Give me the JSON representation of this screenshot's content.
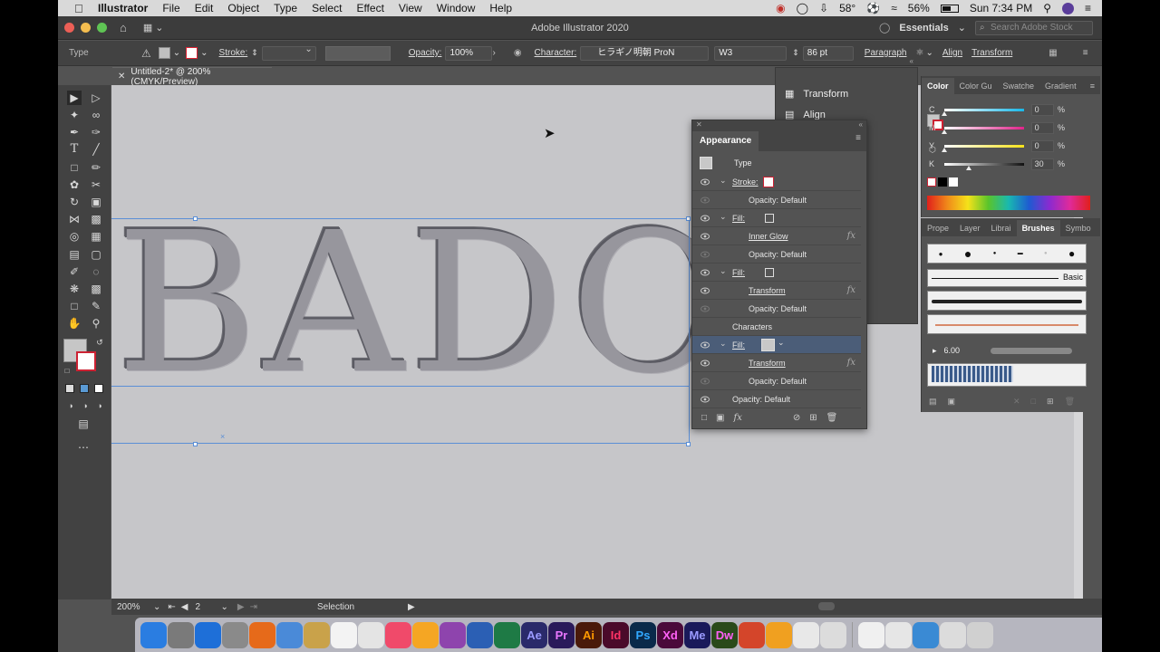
{
  "menubar": {
    "apple": "",
    "app": "Illustrator",
    "items": [
      "File",
      "Edit",
      "Object",
      "Type",
      "Select",
      "Effect",
      "View",
      "Window",
      "Help"
    ],
    "temperature": "58°",
    "battery": "56%",
    "clock": "Sun 7:34 PM"
  },
  "window": {
    "title": "Adobe Illustrator 2020",
    "workspace": "Essentials",
    "search_placeholder": "Search Adobe Stock"
  },
  "controlbar": {
    "selection_type": "Type",
    "stroke_label": "Stroke:",
    "opacity_label": "Opacity:",
    "opacity_value": "100%",
    "character_label": "Character:",
    "font_name": "ヒラギノ明朝 ProN",
    "font_weight": "W3",
    "font_size": "86 pt",
    "paragraph_label": "Paragraph",
    "align_label": "Align",
    "transform_label": "Transform"
  },
  "document": {
    "tab_title": "Untitled-2* @ 200% (CMYK/Preview)",
    "canvas_text": "BADO",
    "zoom": "200%",
    "artboard": "2",
    "status": "Selection"
  },
  "small_panel": {
    "items": [
      "Transform",
      "Align"
    ]
  },
  "appearance": {
    "title": "Appearance",
    "header": "Type",
    "rows": [
      {
        "label": "Stroke:",
        "indent": 1,
        "chevron": true,
        "swatch": "stroke-none"
      },
      {
        "label": "Opacity: Default",
        "indent": 2
      },
      {
        "label": "Fill:",
        "indent": 1,
        "chevron": true,
        "swatch": "dark"
      },
      {
        "label": "Inner Glow",
        "indent": 2,
        "link": true,
        "fx": true
      },
      {
        "label": "Opacity: Default",
        "indent": 2
      },
      {
        "label": "Fill:",
        "indent": 1,
        "chevron": true,
        "swatch": "dark"
      },
      {
        "label": "Transform",
        "indent": 2,
        "link": true,
        "fx": true
      },
      {
        "label": "Opacity: Default",
        "indent": 2
      },
      {
        "label": "Characters",
        "indent": 0
      },
      {
        "label": "Fill:",
        "indent": 1,
        "chevron": true,
        "swatch": "light",
        "selected": true
      },
      {
        "label": "Transform",
        "indent": 2,
        "link": true,
        "fx": true
      },
      {
        "label": "Opacity: Default",
        "indent": 2
      },
      {
        "label": "Opacity: Default",
        "indent": 0
      }
    ],
    "fx_symbol": "fx"
  },
  "color_panel": {
    "tabs": [
      "Color",
      "Color Gu",
      "Swatche",
      "Gradient"
    ],
    "channels": [
      {
        "name": "C",
        "value": "0",
        "fill": 0
      },
      {
        "name": "M",
        "value": "0",
        "fill": 0
      },
      {
        "name": "Y",
        "value": "0",
        "fill": 0
      },
      {
        "name": "K",
        "value": "30",
        "fill": 0.3
      }
    ],
    "percent": "%"
  },
  "brush_panel": {
    "tabs": [
      "Prope",
      "Layer",
      "Librai",
      "Brushes",
      "Symbo"
    ],
    "basic_label": "Basic",
    "size_value": "6.00"
  },
  "dock": {
    "apps": [
      "Finder",
      "Sys",
      "Safari",
      "Launch",
      "Firefox",
      "Preview",
      "Notes",
      "Cal",
      "Chrome",
      "Music",
      "Photos",
      "Podcast",
      "Word",
      "Excel",
      "Ae",
      "Pr",
      "Ai",
      "Id",
      "Ps",
      "Xd",
      "Me",
      "Dw",
      "PPT",
      "Sketch",
      "Slack",
      "?",
      "File",
      "Scrn",
      "Msg",
      "Docs",
      "Trash"
    ]
  },
  "colors": {
    "accent": "#4b5d78",
    "bbox": "#5b8fd6",
    "canvas": "#c6c6c9",
    "text_fill": "#97969d"
  }
}
